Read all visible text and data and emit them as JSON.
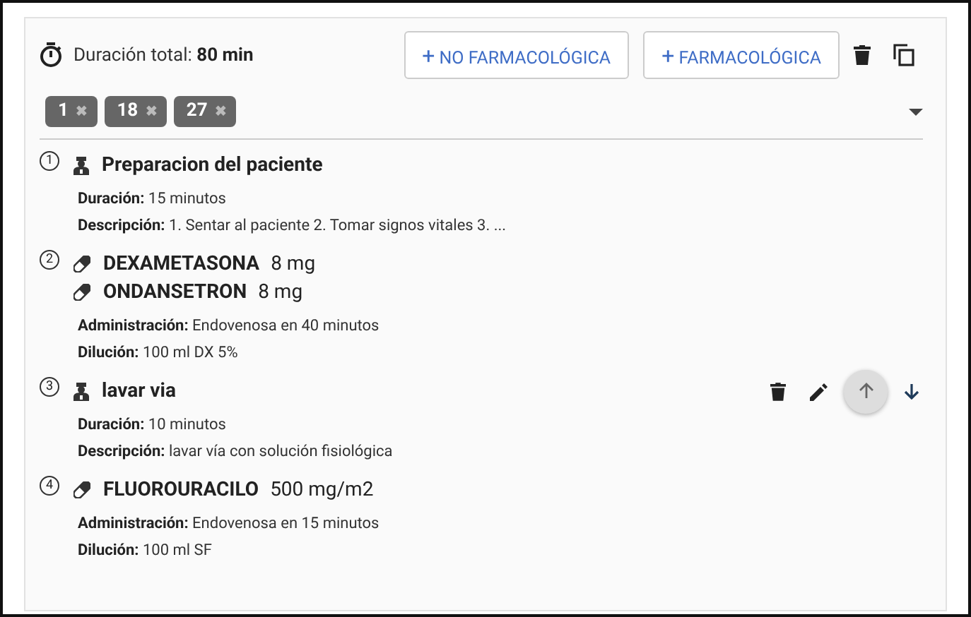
{
  "header": {
    "label": "Duración total:",
    "total": "80 min",
    "buttons": [
      {
        "icon": "+",
        "label": "NO FARMACOLÓGICA"
      },
      {
        "icon": "+",
        "label": "FARMACOLÓGICA"
      }
    ]
  },
  "chips": [
    "1",
    "18",
    "27"
  ],
  "chip_remove": "✖",
  "steps": [
    {
      "number": "1",
      "kind": "procedure",
      "hovered": false,
      "lines": [
        {
          "name": "Preparacion del paciente"
        }
      ],
      "details": [
        {
          "label": "Duración:",
          "value": "15 minutos"
        },
        {
          "label": "Descripción:",
          "value": "1. Sentar al paciente 2. Tomar signos vitales 3. ..."
        }
      ]
    },
    {
      "number": "2",
      "kind": "drug",
      "hovered": false,
      "lines": [
        {
          "name": "DEXAMETASONA",
          "dose": "8 mg"
        },
        {
          "name": "ONDANSETRON",
          "dose": "8 mg"
        }
      ],
      "details": [
        {
          "label": "Administración:",
          "value": "Endovenosa en 40 minutos"
        },
        {
          "label": "Dilución:",
          "value": "100 ml DX 5%"
        }
      ]
    },
    {
      "number": "3",
      "kind": "procedure",
      "hovered": true,
      "lines": [
        {
          "name": "lavar via"
        }
      ],
      "details": [
        {
          "label": "Duración:",
          "value": "10 minutos"
        },
        {
          "label": "Descripción:",
          "value": "lavar vía con solución fisiológica"
        }
      ]
    },
    {
      "number": "4",
      "kind": "drug",
      "hovered": false,
      "lines": [
        {
          "name": "FLUOROURACILO",
          "dose": "500 mg/m2"
        }
      ],
      "details": [
        {
          "label": "Administración:",
          "value": "Endovenosa en 15 minutos"
        },
        {
          "label": "Dilución:",
          "value": "100 ml SF"
        }
      ]
    }
  ]
}
